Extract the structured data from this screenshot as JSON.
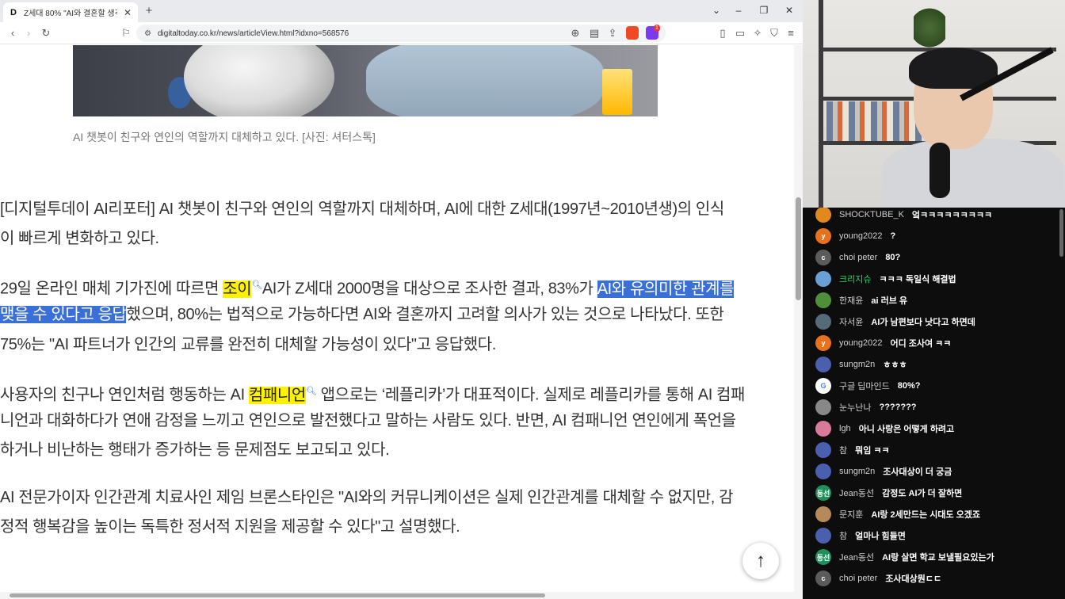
{
  "browser": {
    "tab_title": "Z세대 80% \"AI와 결혼할 생각 있",
    "favicon_letter": "D",
    "new_tab": "+",
    "url": "digitaltoday.co.kr/news/articleView.html?idxno=568576",
    "notification_count": "1"
  },
  "article": {
    "caption": "AI 챗봇이 친구와 연인의 역할까지 대체하고 있다. [사진: 셔터스톡]",
    "p1": {
      "l1": "[디지털투데이 AI리포터] AI 챗봇이 친구와 연인의 역할까지 대체하며, AI에 대한 Z세대(1997년~2010년생)의 인식",
      "l2": "이 빠르게 변화하고 있다."
    },
    "p2": {
      "l1_a": "29일 온라인 매체 기가진에 따르면 ",
      "l1_hl": "조이",
      "l1_b": "AI가 Z세대 2000명을 대상으로 조사한 결과, 83%가 ",
      "l1_sel": "AI와 유의미한 관계를",
      "l2_sel": "맺을 수 있다고 응답",
      "l2_b": "했으며, 80%는 법적으로 가능하다면 AI와 결혼까지 고려할 의사가 있는 것으로 나타났다. 또한",
      "l3": "75%는 \"AI 파트너가 인간의 교류를 완전히 대체할 가능성이 있다\"고 응답했다."
    },
    "p3": {
      "l1_a": "사용자의 친구나 연인처럼 행동하는 AI ",
      "l1_hl": "컴패니언",
      "l1_b": " 앱으로는 ‘레플리카’가 대표적이다. 실제로 레플리카를 통해 AI 컴패",
      "l2": "니언과 대화하다가 연애 감정을 느끼고 연인으로 발전했다고 말하는 사람도 있다. 반면, AI 컴패니언 연인에게 폭언을",
      "l3": "하거나 비난하는 행태가 증가하는 등 문제점도 보고되고 있다."
    },
    "p4": {
      "l1": "AI 전문가이자 인간관계 치료사인 제임 브론스타인은 \"AI와의 커뮤니케이션은 실제 인간관계를 대체할 수 없지만, 감",
      "l2": "정적 행복감을 높이는 독특한 정서적 지원을 제공할 수 있다\"고 설명했다."
    },
    "top_button": "↑"
  },
  "chat": {
    "messages": [
      {
        "user": "SHOCKTUBE_K",
        "text": "엌ㅋㅋㅋㅋㅋㅋㅋㅋㅋ",
        "avatar": "",
        "color": "#e08a1e"
      },
      {
        "user": "young2022",
        "text": "?",
        "avatar": "y",
        "color": "#e8711c"
      },
      {
        "user": "choi peter",
        "text": "80?",
        "avatar": "c",
        "color": "#5b5b5b"
      },
      {
        "user": "크리지슈",
        "text": "ㅋㅋㅋ 독일식 해결법",
        "avatar": "",
        "color": "#6aa0d8",
        "green": true
      },
      {
        "user": "한재윤",
        "text": "ai 러브 유",
        "avatar": "",
        "color": "#4e8f3a"
      },
      {
        "user": "자서윤",
        "text": "AI가 남편보다 낫다고 하면데",
        "avatar": "",
        "color": "#556b7a"
      },
      {
        "user": "young2022",
        "text": "어디 조사여 ㅋㅋ",
        "avatar": "y",
        "color": "#e8711c"
      },
      {
        "user": "sungm2n",
        "text": "ㅎㅎㅎ",
        "avatar": "",
        "color": "#4a5fae"
      },
      {
        "user": "구글 딥마인드",
        "text": "80%?",
        "avatar": "G",
        "color": "#ffffff"
      },
      {
        "user": "눈누난나",
        "text": "???????",
        "avatar": "",
        "color": "#888888"
      },
      {
        "user": "lgh",
        "text": "아니 사랑은 어떻게 하려고",
        "avatar": "",
        "color": "#d87a9b"
      },
      {
        "user": "참",
        "text": "뭐임 ㅋㅋ",
        "avatar": "",
        "color": "#4a5fae"
      },
      {
        "user": "sungm2n",
        "text": "조사대상이 더 궁금",
        "avatar": "",
        "color": "#4a5fae"
      },
      {
        "user": "Jean동선",
        "text": "감정도 AI가 더 잘하면",
        "avatar": "동선",
        "color": "#1f8f5c"
      },
      {
        "user": "문지훈",
        "text": "AI랑 2세만드는 시대도 오겠죠",
        "avatar": "",
        "color": "#b48a5a"
      },
      {
        "user": "참",
        "text": "얼마나 힘들면",
        "avatar": "",
        "color": "#4a5fae"
      },
      {
        "user": "Jean동선",
        "text": "AI랑 살면 학교 보낼필요있는가",
        "avatar": "동선",
        "color": "#1f8f5c"
      },
      {
        "user": "choi peter",
        "text": "조사대상뭔ㄷㄷ",
        "avatar": "c",
        "color": "#5b5b5b"
      }
    ]
  }
}
